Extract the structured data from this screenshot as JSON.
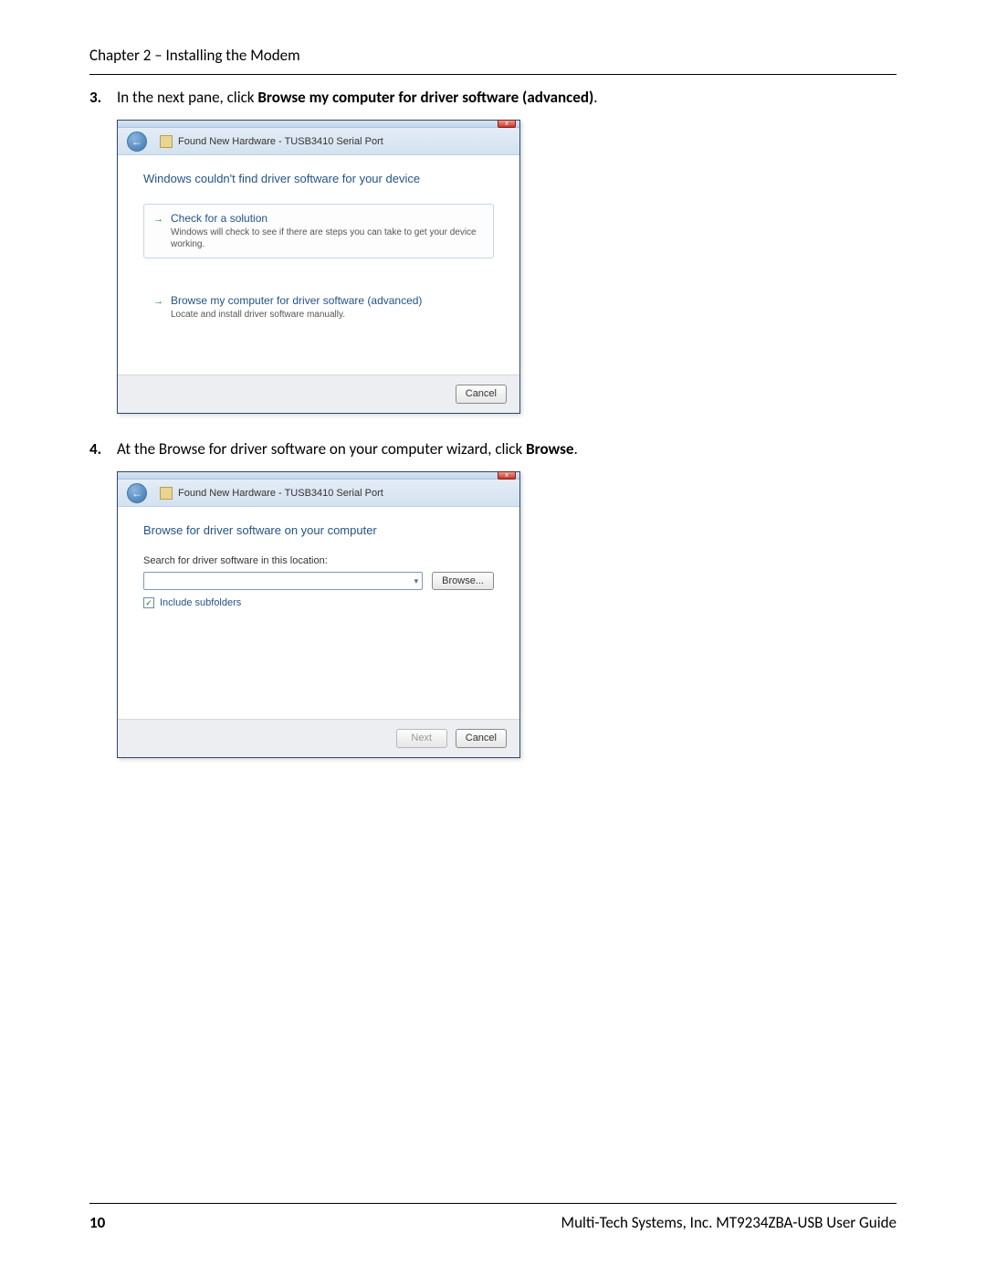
{
  "header": {
    "chapter": "Chapter 2 – Installing the  Modem"
  },
  "step3": {
    "num": "3.",
    "pre": "In the next pane, click ",
    "bold": "Browse my computer for driver software (advanced)",
    "post": "."
  },
  "step4": {
    "num": "4.",
    "pre": "At the Browse for driver software on your computer wizard, click ",
    "bold": "Browse",
    "post": "."
  },
  "dialog1": {
    "close": "x",
    "back": "←",
    "title": "Found New Hardware - TUSB3410 Serial Port",
    "heading": "Windows couldn't find driver software for your device",
    "opt1": {
      "arrow": "→",
      "title": "Check for a solution",
      "desc": "Windows will check to see if there are steps you can take to get your device working."
    },
    "opt2": {
      "arrow": "→",
      "title": "Browse my computer for driver software (advanced)",
      "desc": "Locate and install driver software manually."
    },
    "cancel": "Cancel"
  },
  "dialog2": {
    "close": "x",
    "back": "←",
    "title": "Found New Hardware - TUSB3410 Serial Port",
    "heading": "Browse for driver software on your computer",
    "search_label": "Search for driver software in this location:",
    "combo_caret": "▾",
    "browse_btn": "Browse...",
    "cb_check": "✓",
    "cb_label": "Include subfolders",
    "next": "Next",
    "cancel": "Cancel"
  },
  "footer": {
    "page": "10",
    "guide": "Multi-Tech Systems, Inc. MT9234ZBA-USB User Guide"
  }
}
